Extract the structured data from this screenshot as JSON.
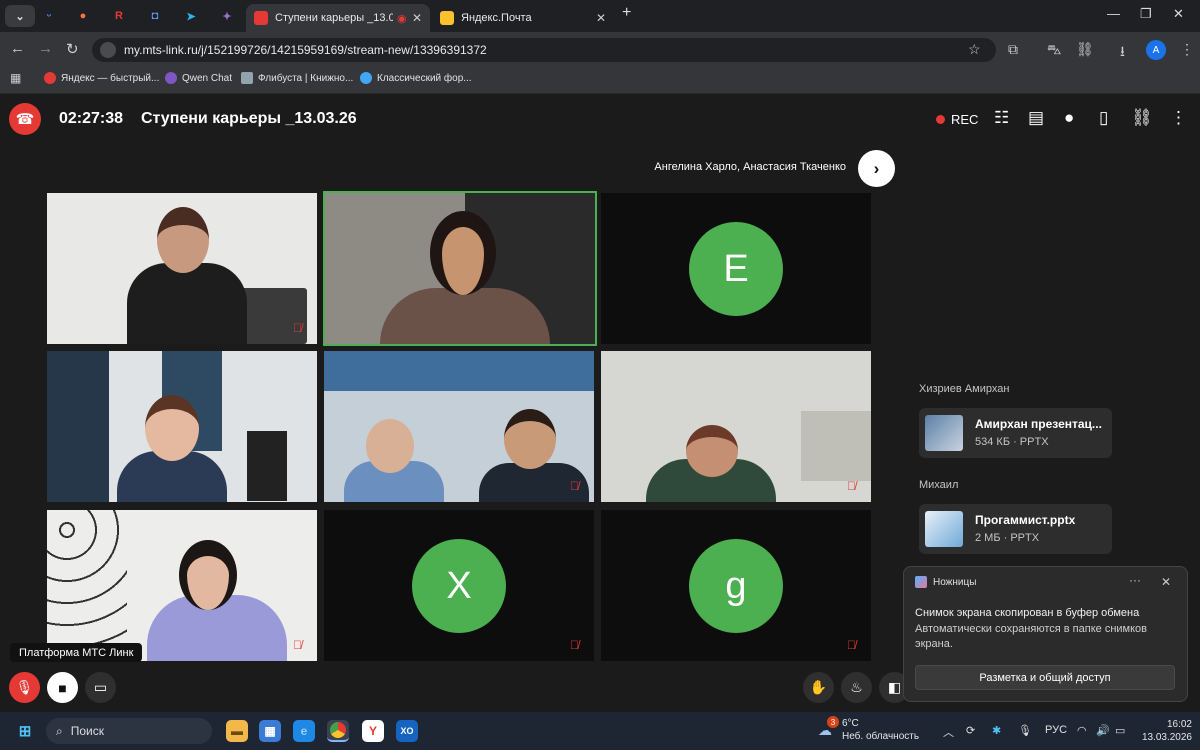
{
  "browser": {
    "tabs": [
      {
        "label": "Ступени карьеры _13.03.2(",
        "active": true
      },
      {
        "label": "Яндекс.Почта",
        "active": false
      }
    ],
    "url": "my.mts-link.ru/j/152199726/14215959169/stream-new/13396391372",
    "profile_initial": "A",
    "bookmarks": [
      "Яндекс — быстрый...",
      "Qwen Chat",
      "Флибуста | Книжно...",
      "Классический фор..."
    ]
  },
  "meeting": {
    "timer": "02:27:38",
    "title": "Ступени карьеры _13.03.26",
    "rec_label": "REC",
    "speakers": "Ангелина Харло, Анастасия Ткаченко",
    "tiles": [
      {
        "type": "video",
        "muted": true
      },
      {
        "type": "video",
        "muted": false,
        "speaking": true
      },
      {
        "type": "avatar",
        "initial": "E",
        "muted": false
      },
      {
        "type": "video",
        "muted": false
      },
      {
        "type": "video",
        "muted": true
      },
      {
        "type": "video",
        "muted": true
      },
      {
        "type": "video",
        "muted": true
      },
      {
        "type": "avatar",
        "initial": "X",
        "muted": true
      },
      {
        "type": "avatar",
        "initial": "g",
        "muted": true
      }
    ],
    "platform_label": "Платформа МТС Линк",
    "files": [
      {
        "sender": "Хизриев Амирхан",
        "name": "Амирхан презентац...",
        "meta": "534 КБ · PPTX"
      },
      {
        "sender": "Михаил",
        "name": "Прогаммист.pptx",
        "meta": "2 МБ · PPTX"
      }
    ]
  },
  "toast": {
    "app": "Ножницы",
    "heading": "Снимок экрана скопирован в буфер обмена",
    "body": "Автоматически сохраняются в папке снимков экрана.",
    "button": "Разметка и общий доступ"
  },
  "taskbar": {
    "search": "Поиск",
    "weather_temp": "6°C",
    "weather_desc": "Неб. облачность",
    "weather_badge": "3",
    "lang": "РУС",
    "time": "16:02",
    "date": "13.03.2026"
  },
  "colors": {
    "accent_green": "#4caf50",
    "hangup_red": "#e53935",
    "background": "#1b1b1b"
  }
}
